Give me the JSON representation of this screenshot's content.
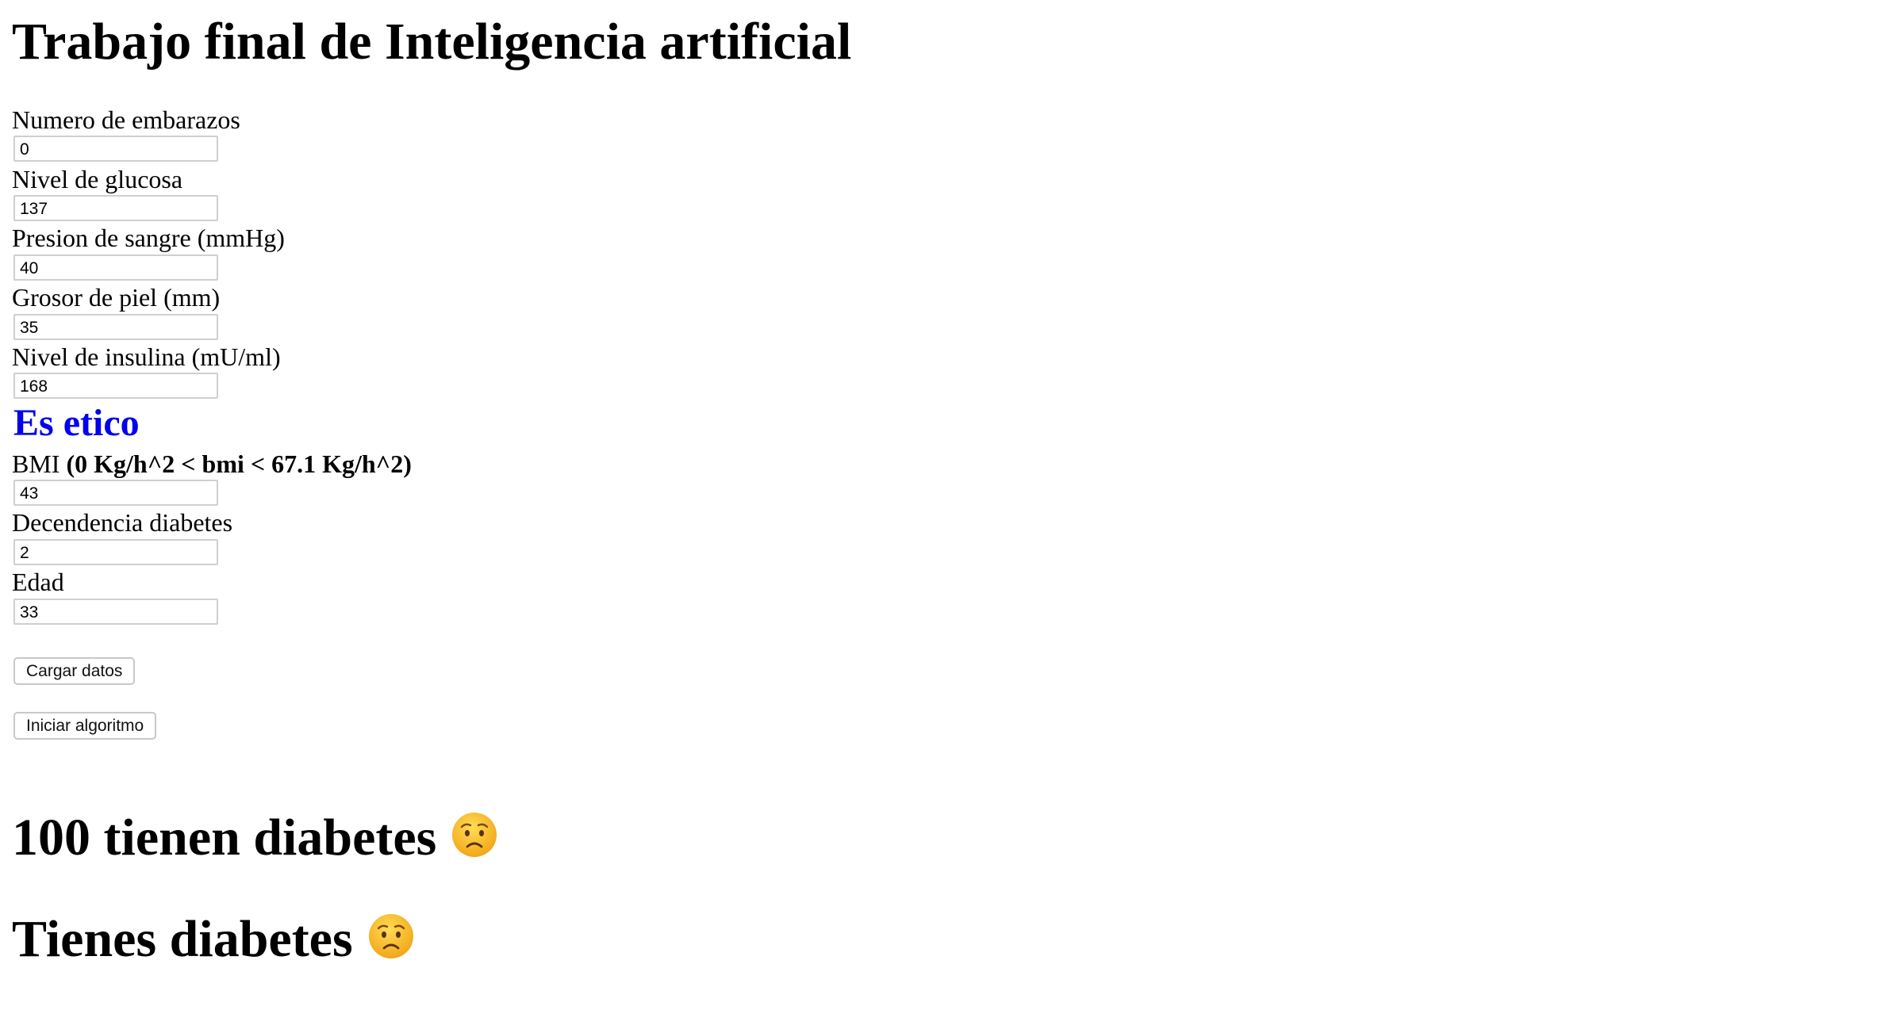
{
  "page": {
    "title": "Trabajo final de Inteligencia artificial"
  },
  "form": {
    "fields": [
      {
        "label": "Numero de embarazos",
        "value": "0"
      },
      {
        "label": "Nivel de glucosa",
        "value": "137"
      },
      {
        "label": "Presion de sangre (mmHg)",
        "value": "40"
      },
      {
        "label": "Grosor de piel (mm)",
        "value": "35"
      },
      {
        "label": "Nivel de insulina (mU/ml)",
        "value": "168"
      }
    ],
    "ethic_heading": "Es etico",
    "bmi": {
      "label_prefix": "BMI ",
      "label_range": "(0 Kg/h^2 < bmi < 67.1 Kg/h^2)",
      "value": "43"
    },
    "fields_after": [
      {
        "label": "Decendencia diabetes",
        "value": "2"
      },
      {
        "label": "Edad",
        "value": "33"
      }
    ]
  },
  "buttons": {
    "load_data": "Cargar datos",
    "start_algorithm": "Iniciar algoritmo"
  },
  "results": {
    "count_text": "100 tienen diabetes",
    "diagnosis_text": "Tienes diabetes",
    "emoji_icon": "worried-face-icon",
    "emoji_color": "#f7b528"
  }
}
